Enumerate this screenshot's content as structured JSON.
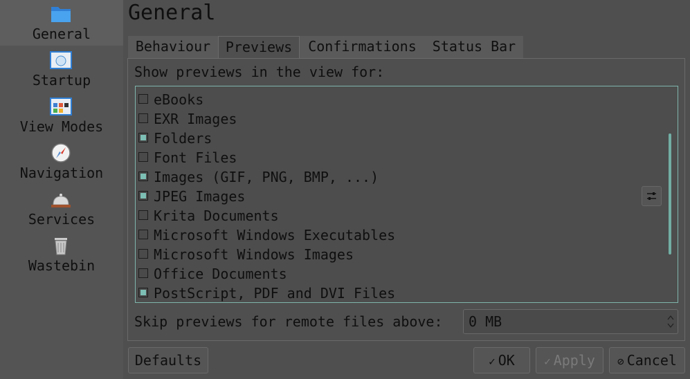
{
  "sidebar": {
    "items": [
      {
        "label": "General",
        "icon": "folder-icon",
        "active": true
      },
      {
        "label": "Startup",
        "icon": "startup-icon",
        "active": false
      },
      {
        "label": "View Modes",
        "icon": "view-modes-icon",
        "active": false
      },
      {
        "label": "Navigation",
        "icon": "compass-icon",
        "active": false
      },
      {
        "label": "Services",
        "icon": "bell-icon",
        "active": false
      },
      {
        "label": "Wastebin",
        "icon": "trash-icon",
        "active": false
      }
    ]
  },
  "page": {
    "title": "General"
  },
  "tabs": [
    {
      "label": "Behaviour",
      "active": false
    },
    {
      "label": "Previews",
      "active": true
    },
    {
      "label": "Confirmations",
      "active": false
    },
    {
      "label": "Status Bar",
      "active": false
    }
  ],
  "previews": {
    "section_label": "Show previews in the view for:",
    "items": [
      {
        "label": "eBooks",
        "checked": false
      },
      {
        "label": "EXR Images",
        "checked": false
      },
      {
        "label": "Folders",
        "checked": true
      },
      {
        "label": "Font Files",
        "checked": false
      },
      {
        "label": "Images (GIF, PNG, BMP, ...)",
        "checked": true
      },
      {
        "label": "JPEG Images",
        "checked": true
      },
      {
        "label": "Krita Documents",
        "checked": false
      },
      {
        "label": "Microsoft Windows Executables",
        "checked": false
      },
      {
        "label": "Microsoft Windows Images",
        "checked": false
      },
      {
        "label": "Office Documents",
        "checked": false
      },
      {
        "label": "PostScript, PDF and DVI Files",
        "checked": true
      }
    ],
    "skip_label": "Skip previews for remote files above:",
    "skip_value": "0 MB"
  },
  "buttons": {
    "defaults": "Defaults",
    "ok": "OK",
    "apply": "Apply",
    "cancel": "Cancel"
  },
  "colors": {
    "accent": "#7dbfb4",
    "background": "#4f4f4f"
  }
}
